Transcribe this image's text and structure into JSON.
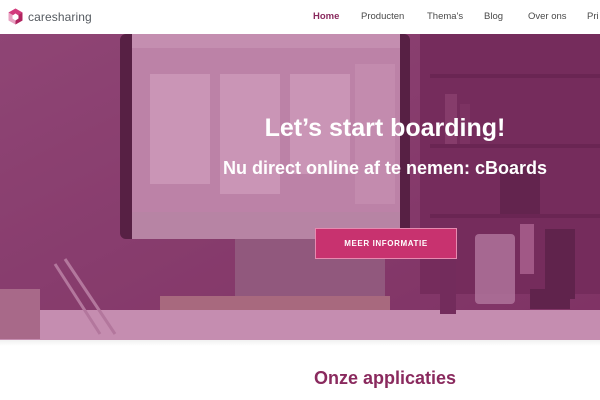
{
  "brand": {
    "name": "caresharing"
  },
  "nav": {
    "items": [
      {
        "label": "Home",
        "active": true
      },
      {
        "label": "Producten",
        "active": false
      },
      {
        "label": "Thema's",
        "active": false
      },
      {
        "label": "Blog",
        "active": false
      },
      {
        "label": "Over ons",
        "active": false
      },
      {
        "label": "Pri",
        "active": false
      }
    ]
  },
  "hero": {
    "title": "Let’s start boarding!",
    "subtitle": "Nu direct online af te nemen: cBoards",
    "cta_label": "MEER INFORMATIE"
  },
  "section": {
    "title": "Onze applicaties"
  },
  "colors": {
    "accent": "#8a2a5e",
    "cta": "#c8326f",
    "overlay": "#962e6e"
  }
}
